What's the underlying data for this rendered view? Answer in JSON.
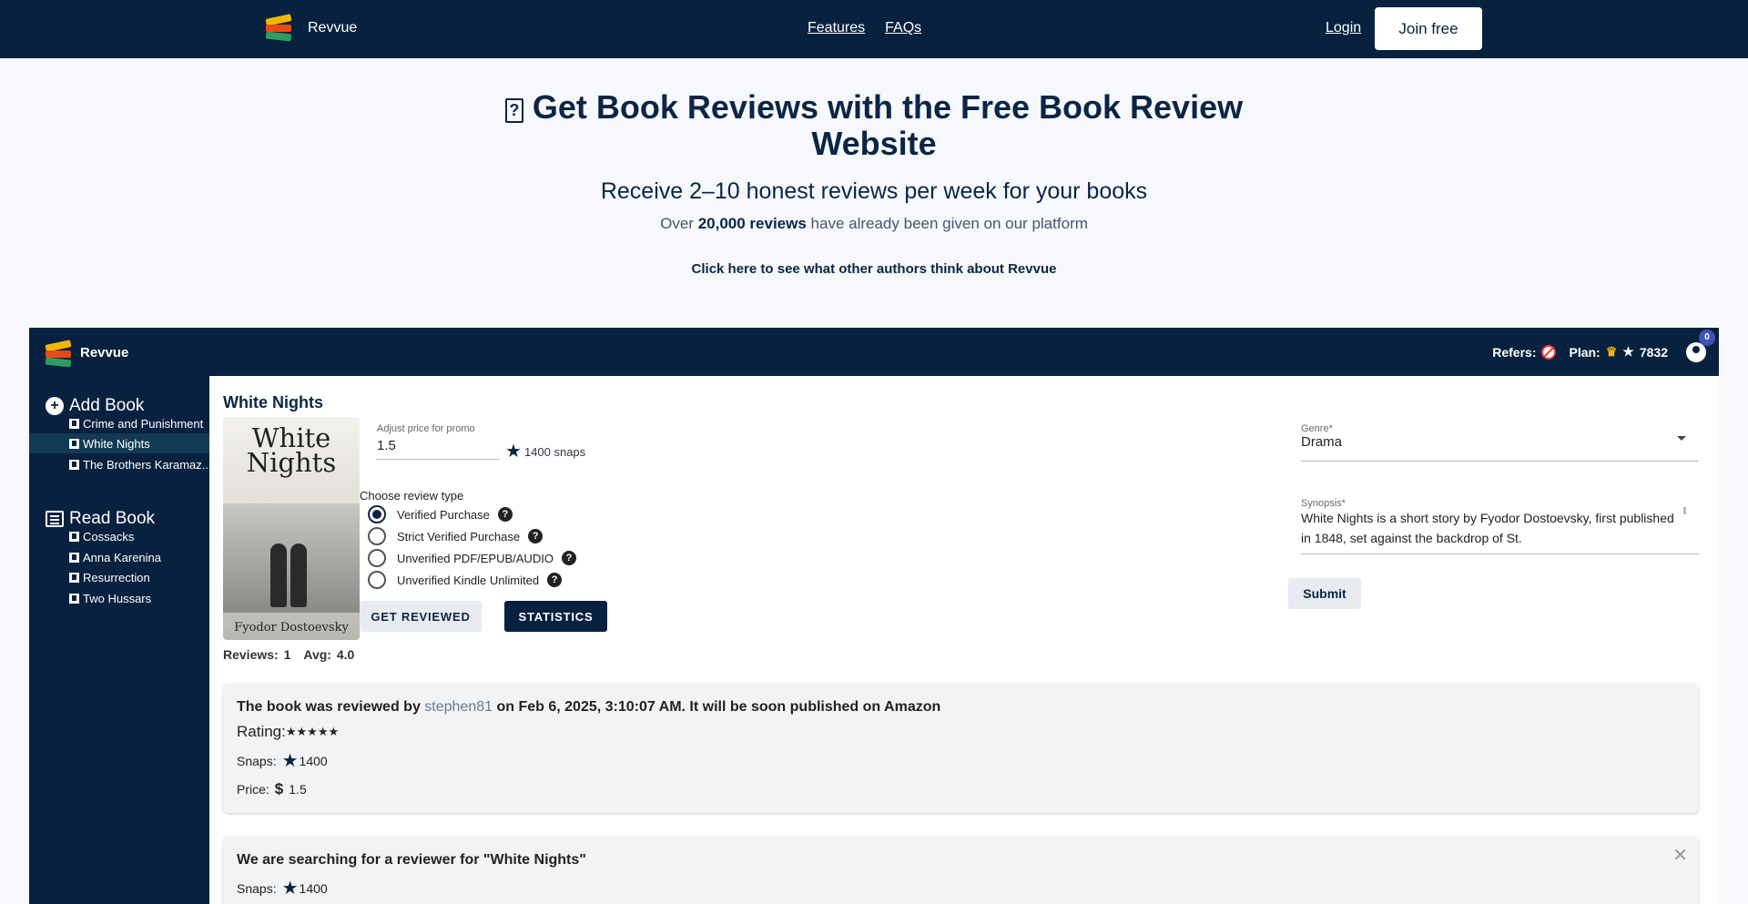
{
  "nav": {
    "brand": "Revvue",
    "links": [
      "Features",
      "FAQs"
    ],
    "login": "Login",
    "join": "Join free"
  },
  "hero": {
    "title": "Get Book Reviews with the Free Book Review Website",
    "title_icon_glyph": "?",
    "subtitle": "Receive 2–10 honest reviews per week for your books",
    "stat_prefix": "Over",
    "stat_bold": "20,000 reviews",
    "stat_suffix": "have already been given on our platform",
    "testimonial_link": "Click here to see what other authors think about Revvue"
  },
  "app": {
    "brand": "Revvue",
    "topbar": {
      "refers_label": "Refers:",
      "plan_label": "Plan:",
      "plan_icon": "crown-icon",
      "snaps_total": "7832",
      "notification_count": "0"
    },
    "sidebar": {
      "add_book": "Add Book",
      "added_books": [
        "Crime and Punishment",
        "White Nights",
        "The Brothers Karamaz..."
      ],
      "active_book": "White Nights",
      "read_book": "Read Book",
      "read_books": [
        "Cossacks",
        "Anna Karenina",
        "Resurrection",
        "Two Hussars"
      ]
    },
    "book": {
      "title": "White Nights",
      "cover_title_line1": "White",
      "cover_title_line2": "Nights",
      "cover_author": "Fyodor Dostoevsky",
      "price_label": "Adjust price for promo",
      "price_value": "1.5",
      "snaps": "1400 snaps",
      "review_type_label": "Choose review type",
      "review_types": [
        {
          "label": "Verified Purchase",
          "selected": true
        },
        {
          "label": "Strict Verified Purchase",
          "selected": false
        },
        {
          "label": "Unverified PDF/EPUB/AUDIO",
          "selected": false
        },
        {
          "label": "Unverified Kindle Unlimited",
          "selected": false
        }
      ],
      "get_reviewed": "GET REVIEWED",
      "statistics": "STATISTICS",
      "reviews_count": "Reviews: 1",
      "avg": "Avg: 4.0",
      "genre_label": "Genre*",
      "genre_value": "Drama",
      "synopsis_label": "Synopsis*",
      "synopsis_value": "White Nights is a short story by Fyodor Dostoevsky, first published in 1848, set against the backdrop of St.",
      "submit": "Submit"
    },
    "review_card": {
      "prefix": "The book was reviewed by",
      "user": "stephen81",
      "suffix": "on Feb 6, 2025, 3:10:07 AM. It will be soon published on Amazon",
      "rating_label": "Rating:",
      "rating_stars": "★★★★★",
      "snaps_label": "Snaps:",
      "snaps_value": "1400",
      "price_label": "Price:",
      "price_value": "1.5"
    },
    "search_card": {
      "text": "We are searching for a reviewer for \"White Nights\"",
      "snaps_label": "Snaps:",
      "snaps_value": "1400"
    }
  },
  "colors": {
    "navy": "#08213f",
    "accent_blue": "#3f51b5",
    "crown": "#f2b705"
  }
}
